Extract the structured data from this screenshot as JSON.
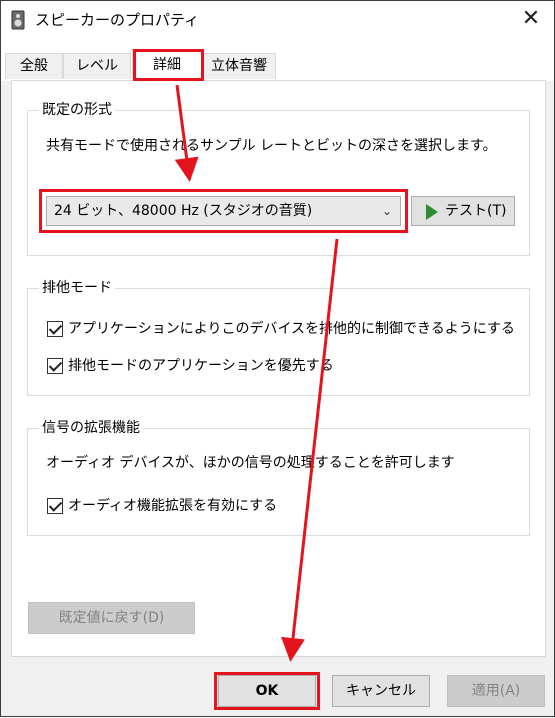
{
  "window": {
    "title": "スピーカーのプロパティ",
    "close_glyph": "✕"
  },
  "tabs": [
    {
      "label": "全般",
      "active": false
    },
    {
      "label": "レベル",
      "active": false
    },
    {
      "label": "詳細",
      "active": true
    },
    {
      "label": "立体音響",
      "active": false
    }
  ],
  "default_format": {
    "title": "既定の形式",
    "description": "共有モードで使用されるサンプル レートとビットの深さを選択します。",
    "selected": "24 ビット、48000 Hz (スタジオの音質)",
    "test_label": "テスト(T)"
  },
  "exclusive_mode": {
    "title": "排他モード",
    "options": [
      {
        "label": "アプリケーションによりこのデバイスを排他的に制御できるようにする",
        "checked": true
      },
      {
        "label": "排他モードのアプリケーションを優先する",
        "checked": true
      }
    ]
  },
  "enhancements": {
    "title": "信号の拡張機能",
    "description": "オーディオ デバイスが、ほかの信号の処理することを許可します",
    "option": {
      "label": "オーディオ機能拡張を有効にする",
      "checked": true
    }
  },
  "restore_default_label": "既定値に戻す(D)",
  "buttons": {
    "ok": "OK",
    "cancel": "キャンセル",
    "apply": "適用(A)"
  },
  "colors": {
    "highlight": "#e5141c",
    "play": "#2e8b2e"
  }
}
